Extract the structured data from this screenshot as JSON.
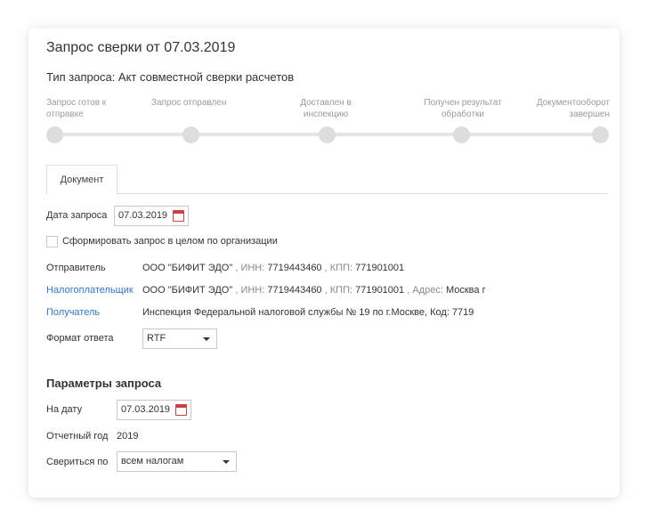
{
  "header": {
    "title": "Запрос сверки от 07.03.2019",
    "request_type": "Тип запроса: Акт совместной сверки расчетов"
  },
  "progress": {
    "steps": [
      {
        "line1": "Запрос готов к",
        "line2": "отправке"
      },
      {
        "line1": "Запрос отправлен",
        "line2": ""
      },
      {
        "line1": "Доставлен в",
        "line2": "инспекцию"
      },
      {
        "line1": "Получен результат",
        "line2": "обработки"
      },
      {
        "line1": "Документооборот",
        "line2": "завершен"
      }
    ]
  },
  "tabs": [
    {
      "label": "Документ"
    }
  ],
  "form": {
    "request_date_label": "Дата запроса",
    "request_date_value": "07.03.2019",
    "whole_org_label": "Сформировать запрос в целом по организации",
    "sender": {
      "label": "Отправитель",
      "org": "ООО \"БИФИТ ЭДО\"",
      "sep1": ",",
      "inn_label": "ИНН:",
      "inn": "7719443460",
      "sep2": ",",
      "kpp_label": "КПП:",
      "kpp": "771901001"
    },
    "taxpayer": {
      "label": "Налогоплательщик",
      "org": "ООО \"БИФИТ ЭДО\"",
      "sep1": ",",
      "inn_label": "ИНН:",
      "inn": "7719443460",
      "sep2": ",",
      "kpp_label": "КПП:",
      "kpp": "771901001",
      "sep3": ",",
      "address_label": "Адрес:",
      "address": "Москва г"
    },
    "recipient": {
      "label": "Получатель",
      "value": "Инспекция Федеральной налоговой службы № 19 по г.Москве, Код: 7719"
    },
    "response_format": {
      "label": "Формат ответа",
      "value": "RTF"
    }
  },
  "params": {
    "title": "Параметры запроса",
    "on_date_label": "На дату",
    "on_date_value": "07.03.2019",
    "report_year_label": "Отчетный год",
    "report_year_value": "2019",
    "reconcile_by_label": "Свериться по",
    "reconcile_by_value": "всем налогам"
  },
  "colors": {
    "link": "#2f76c2",
    "calendar": "#c94040",
    "step_dot": "#dddddd"
  }
}
